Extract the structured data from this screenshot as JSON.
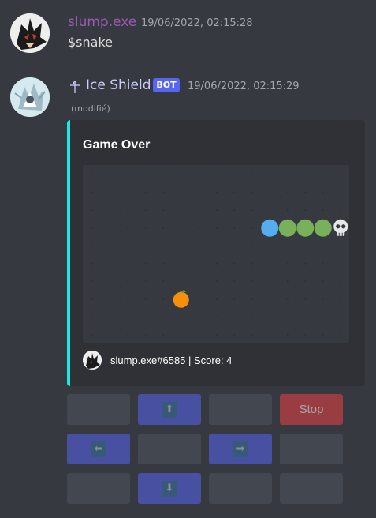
{
  "messages": [
    {
      "author": "slump.exe",
      "author_color": "#9b59b6",
      "timestamp": "19/06/2022, 02:15:28",
      "text": "$snake"
    },
    {
      "author": "Ice Shield",
      "author_color": "#c9cdfb",
      "author_prefix_icon": "sword-icon",
      "badge": "BOT",
      "timestamp": "19/06/2022, 02:15:29",
      "edited": "(modifié)"
    }
  ],
  "embed": {
    "accent_color": "#1de9e4",
    "title": "Game Over",
    "footer": "slump.exe#6585 | Score: 4",
    "board": {
      "cols": 15,
      "rows": 10,
      "snake_head": {
        "col": 10,
        "row": 3,
        "color": "#55acee"
      },
      "snake_body": [
        {
          "col": 11,
          "row": 3
        },
        {
          "col": 12,
          "row": 3
        },
        {
          "col": 13,
          "row": 3
        }
      ],
      "body_color": "#78b159",
      "dead_marker": {
        "col": 14,
        "row": 3,
        "icon": "skull-icon"
      },
      "food": {
        "col": 5,
        "row": 7,
        "icon": "orange-icon"
      }
    }
  },
  "buttons": [
    [
      {
        "label": "",
        "style": "grey"
      },
      {
        "icon": "arrow-up-icon",
        "glyph": "⬆",
        "style": "blurple"
      },
      {
        "label": "",
        "style": "grey"
      },
      {
        "label": "Stop",
        "style": "red"
      }
    ],
    [
      {
        "icon": "arrow-left-icon",
        "glyph": "⬅",
        "style": "blurple"
      },
      {
        "label": "",
        "style": "grey"
      },
      {
        "icon": "arrow-right-icon",
        "glyph": "➡",
        "style": "blurple"
      },
      {
        "label": "",
        "style": "grey"
      }
    ],
    [
      {
        "label": "",
        "style": "grey"
      },
      {
        "icon": "arrow-down-icon",
        "glyph": "⬇",
        "style": "blurple"
      },
      {
        "label": "",
        "style": "grey"
      },
      {
        "label": "",
        "style": "grey"
      }
    ]
  ]
}
